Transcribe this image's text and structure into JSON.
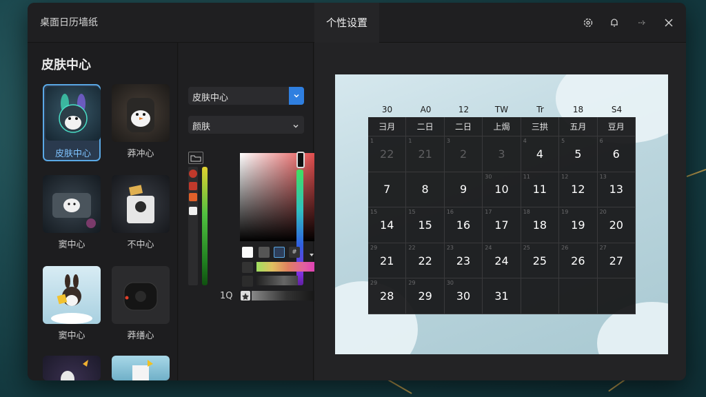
{
  "app": {
    "title": "桌面日历墙纸"
  },
  "tabs": [
    {
      "label": "个性设置",
      "active": true
    }
  ],
  "titlebar_icons": [
    "settings-icon",
    "bell-icon",
    "arrow-icon",
    "close-icon"
  ],
  "sidebar": {
    "title": "皮肤中心",
    "skins": [
      {
        "label": "皮肤中心",
        "selected": true
      },
      {
        "label": "莽冲心"
      },
      {
        "label": "窦中心"
      },
      {
        "label": "不中心"
      },
      {
        "label": "窦中心"
      },
      {
        "label": "莽缮心"
      },
      {
        "label": ""
      },
      {
        "label": ""
      }
    ]
  },
  "controls": {
    "dropdown1": {
      "value": "皮肤中心"
    },
    "dropdown2": {
      "value": "颜肤"
    },
    "size_value": "1Q"
  },
  "calendar": {
    "header_numbers": [
      "30",
      "A0",
      "12",
      "TW",
      "Tr",
      "18",
      "S4"
    ],
    "dow": [
      "彐月",
      "二日",
      "二日",
      "上焗",
      "三拱",
      "五月",
      "豆月"
    ],
    "weeks": [
      [
        {
          "d": "22",
          "dim": true,
          "s": "1"
        },
        {
          "d": "21",
          "dim": true,
          "s": "1"
        },
        {
          "d": "2",
          "dim": true,
          "s": "3"
        },
        {
          "d": "3",
          "dim": true,
          "s": ""
        },
        {
          "d": "4",
          "s": "4"
        },
        {
          "d": "5",
          "s": "5"
        },
        {
          "d": "6",
          "s": "6"
        }
      ],
      [
        {
          "d": "7",
          "s": ""
        },
        {
          "d": "8",
          "s": ""
        },
        {
          "d": "9",
          "s": ""
        },
        {
          "d": "10",
          "s": "30"
        },
        {
          "d": "11",
          "s": "11"
        },
        {
          "d": "12",
          "s": "12"
        },
        {
          "d": "13",
          "s": "13"
        }
      ],
      [
        {
          "d": "14",
          "s": "15"
        },
        {
          "d": "15",
          "s": "15"
        },
        {
          "d": "16",
          "s": "16"
        },
        {
          "d": "17",
          "s": "17"
        },
        {
          "d": "18",
          "s": "18"
        },
        {
          "d": "19",
          "s": "19"
        },
        {
          "d": "20",
          "s": "20"
        }
      ],
      [
        {
          "d": "21",
          "s": "29"
        },
        {
          "d": "22",
          "s": "22"
        },
        {
          "d": "23",
          "s": "23"
        },
        {
          "d": "24",
          "s": "24"
        },
        {
          "d": "25",
          "s": "25"
        },
        {
          "d": "26",
          "s": "26"
        },
        {
          "d": "27",
          "s": "27"
        }
      ],
      [
        {
          "d": "28",
          "s": "29"
        },
        {
          "d": "29",
          "s": "29"
        },
        {
          "d": "30",
          "s": "30"
        },
        {
          "d": "31",
          "s": ""
        },
        {
          "d": "",
          "s": ""
        },
        {
          "d": "",
          "s": ""
        },
        {
          "d": "",
          "s": ""
        }
      ]
    ]
  },
  "colors": {
    "accent": "#2f7fe0",
    "selected_border": "#5aa9e6"
  }
}
